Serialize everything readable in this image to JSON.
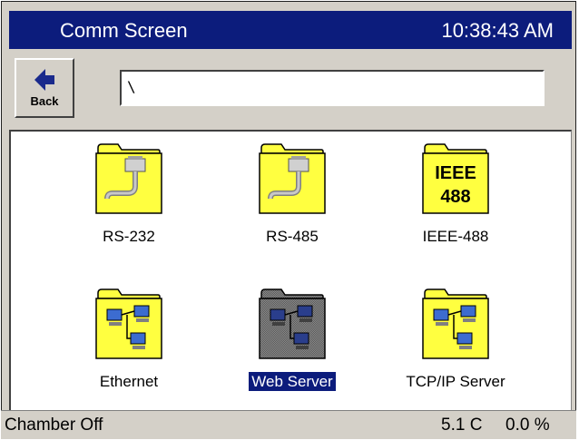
{
  "window": {
    "title": "Comm Screen",
    "clock": "10:38:43 AM"
  },
  "toolbar": {
    "back_label": "Back",
    "path_value": "\\"
  },
  "items": [
    {
      "label": "RS-232",
      "icon": "serial-cable-folder-icon"
    },
    {
      "label": "RS-485",
      "icon": "serial-cable-folder-icon"
    },
    {
      "label": "IEEE-488",
      "icon": "ieee-488-folder-icon",
      "icon_text": [
        "IEEE",
        "488"
      ]
    },
    {
      "label": "Ethernet",
      "icon": "network-folder-icon"
    },
    {
      "label": "Web Server",
      "icon": "network-folder-icon",
      "selected": true
    },
    {
      "label": "TCP/IP Server",
      "icon": "network-folder-icon"
    }
  ],
  "status": {
    "chamber": "Chamber Off",
    "temperature": "5.1 C",
    "percent": "0.0 %"
  },
  "colors": {
    "title_bg": "#0c1c7c",
    "folder_yellow": "#ffff40",
    "selection": "#0c1c7c",
    "chrome": "#d4d0c8"
  }
}
